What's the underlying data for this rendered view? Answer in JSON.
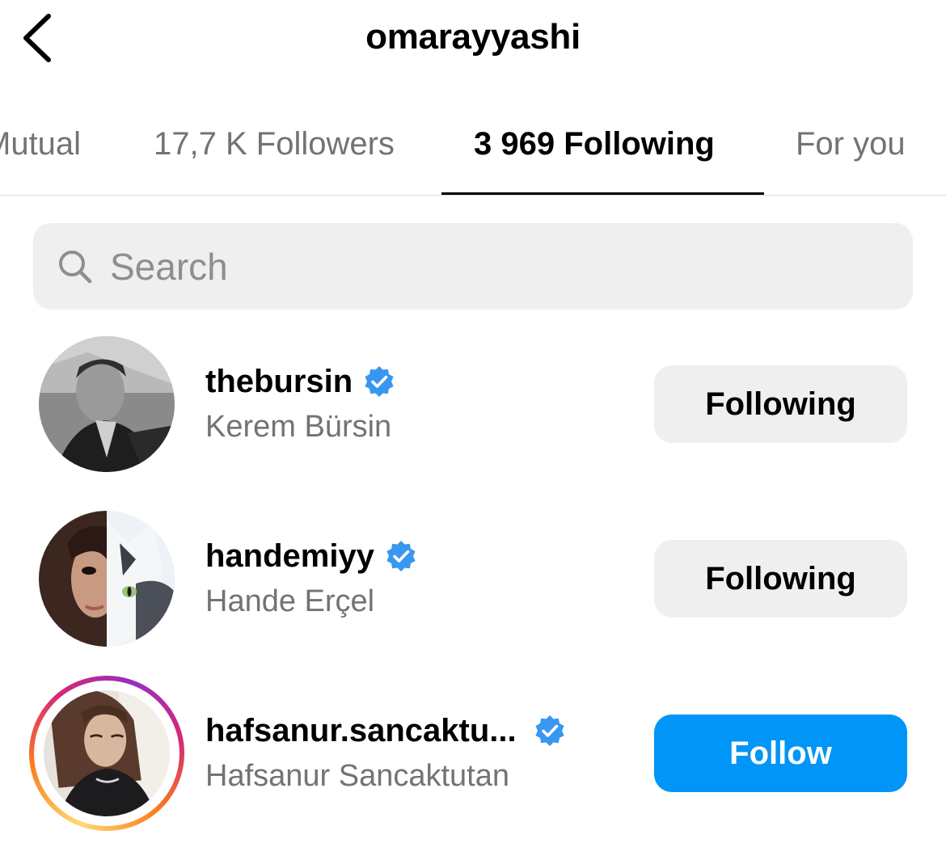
{
  "header": {
    "title": "omarayyashi",
    "back_icon": "chevron-left-icon"
  },
  "tabs": [
    {
      "label": "Mutual",
      "active": false
    },
    {
      "label": "17,7 K Followers",
      "active": false
    },
    {
      "label": "3 969 Following",
      "active": true
    },
    {
      "label": "For you",
      "active": false
    }
  ],
  "search": {
    "placeholder": "Search",
    "value": "",
    "icon": "search-icon"
  },
  "colors": {
    "follow_blue": "#0095f6",
    "verified_blue": "#3897f0",
    "secondary_text": "#737373",
    "button_gray": "#efefef"
  },
  "users": [
    {
      "username": "thebursin",
      "full_name": "Kerem Bürsin",
      "verified": true,
      "has_story": false,
      "button_label": "Following"
    },
    {
      "username": "handemiyy",
      "full_name": "Hande Erçel",
      "verified": true,
      "has_story": false,
      "button_label": "Following"
    },
    {
      "username": "hafsanur.sancaktu...",
      "full_name": "Hafsanur Sancaktutan",
      "verified": true,
      "has_story": true,
      "button_label": "Follow"
    }
  ]
}
